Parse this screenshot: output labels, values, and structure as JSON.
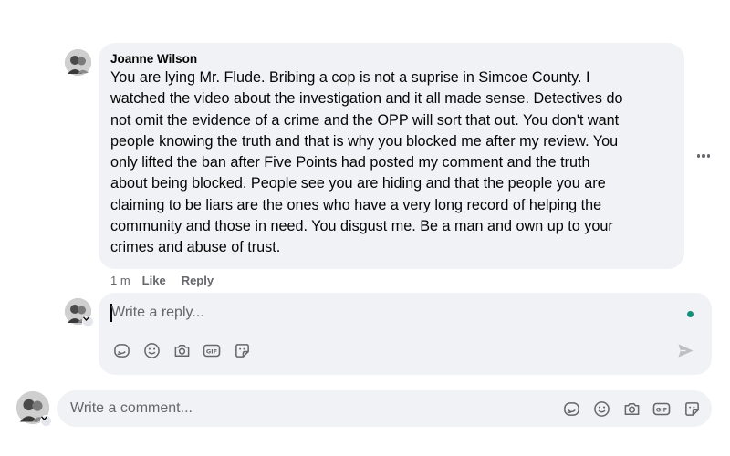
{
  "comment": {
    "author": "Joanne Wilson",
    "lines": [
      "You are lying Mr. Flude. Bribing a cop is not a suprise in Simcoe County. I",
      "watched the video about the investigation and it all made sense. Detectives do",
      "not omit the evidence of a crime and the OPP will sort that out. You don't want",
      "people knowing the truth and that is why you blocked me after my review. You",
      "only lifted the ban after Five Points had posted my comment and the truth",
      "about being blocked. People see you are hiding and that the people you are",
      "claiming to be liars are the ones who have a very long record of helping the",
      "community and those in need. You disgust me. Be a man and own up to your",
      "crimes and abuse of trust."
    ],
    "timestamp": "1 m",
    "like_label": "Like",
    "reply_label": "Reply",
    "more_icon": "more-horizontal-icon"
  },
  "reply_box": {
    "placeholder": "Write a reply...",
    "online_color": "#148f7a",
    "tools": [
      "avatar-sticker-icon",
      "emoji-icon",
      "camera-icon",
      "gif-icon",
      "sticker-icon"
    ],
    "send_icon": "send-icon"
  },
  "comment_box": {
    "placeholder": "Write a comment...",
    "tools": [
      "avatar-sticker-icon",
      "emoji-icon",
      "camera-icon",
      "gif-icon",
      "sticker-icon"
    ]
  },
  "colors": {
    "bubble_bg": "#f0f2f5",
    "secondary_text": "#65676b",
    "primary_text": "#050505"
  }
}
